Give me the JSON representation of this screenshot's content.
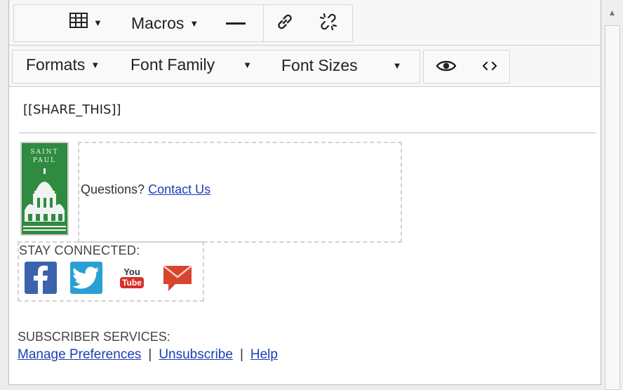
{
  "toolbar": {
    "table_icon": "table-icon",
    "macros_label": "Macros",
    "hr_icon": "horizontal-rule-icon",
    "link_icon": "link-icon",
    "unlink_icon": "unlink-icon",
    "formats_label": "Formats",
    "font_family_label": "Font Family",
    "font_sizes_label": "Font Sizes",
    "preview_icon": "eye-icon",
    "source_icon": "source-code-icon"
  },
  "content": {
    "share_token": "[[SHARE_THIS]]",
    "logo": {
      "line1": "SAINT",
      "line2": "PAUL",
      "color": "#2f8b3f"
    },
    "questions_text": "Questions?",
    "contact_link": "Contact Us",
    "stay_connected": "STAY CONNECTED:",
    "social": [
      {
        "name": "facebook-icon",
        "color": "#3b63ad"
      },
      {
        "name": "twitter-icon",
        "color": "#2a9fd6"
      },
      {
        "name": "youtube-icon",
        "color": "#d8312b",
        "text_top": "You",
        "text_bottom": "Tube"
      },
      {
        "name": "email-icon",
        "color": "#d8452e"
      }
    ],
    "subscriber_services": "SUBSCRIBER SERVICES:",
    "links": {
      "manage": "Manage Preferences",
      "sep1": "|",
      "unsubscribe": "Unsubscribe",
      "sep2": "|",
      "help": "Help"
    }
  },
  "colors": {
    "link": "#1a3fb5",
    "toolbar_bg": "#f7f7f7"
  }
}
